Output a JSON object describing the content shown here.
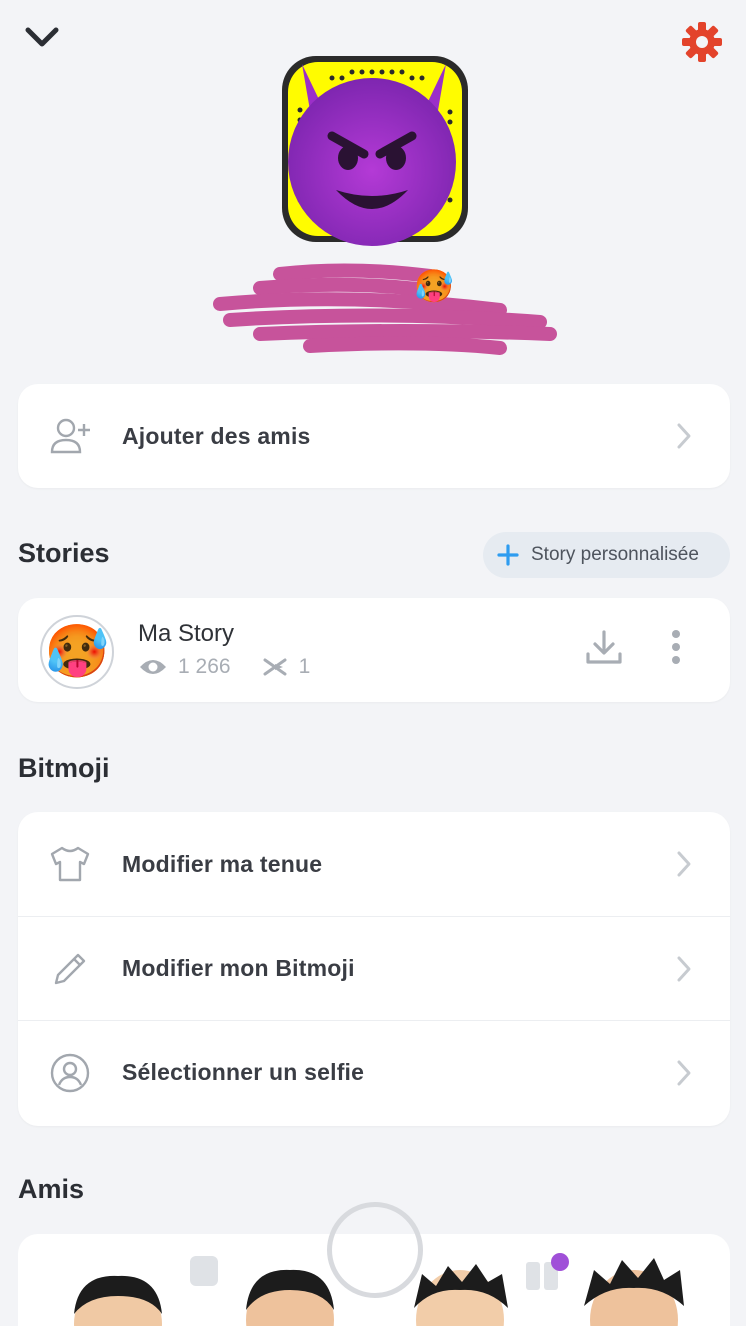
{
  "header": {
    "back_icon": "chevron-down-icon",
    "settings_icon": "gear-icon",
    "accent_color": "#e3432b"
  },
  "profile": {
    "snapcode_color": "#fffc00",
    "avatar_emoji": "😈",
    "status_emoji": "🥵"
  },
  "add_friends": {
    "label": "Ajouter des amis",
    "icon": "add-user-icon"
  },
  "stories": {
    "title": "Stories",
    "custom_story_label": "Story personnalisée",
    "my_story": {
      "title": "Ma Story",
      "avatar_emoji": "🥵",
      "views": "1 266",
      "screenshots": "1"
    }
  },
  "bitmoji": {
    "title": "Bitmoji",
    "items": [
      {
        "label": "Modifier ma tenue",
        "icon": "tshirt-icon"
      },
      {
        "label": "Modifier mon Bitmoji",
        "icon": "pencil-icon"
      },
      {
        "label": "Sélectionner un selfie",
        "icon": "selfie-icon"
      }
    ]
  },
  "friends": {
    "title": "Amis",
    "notification_color": "#a050d8"
  }
}
